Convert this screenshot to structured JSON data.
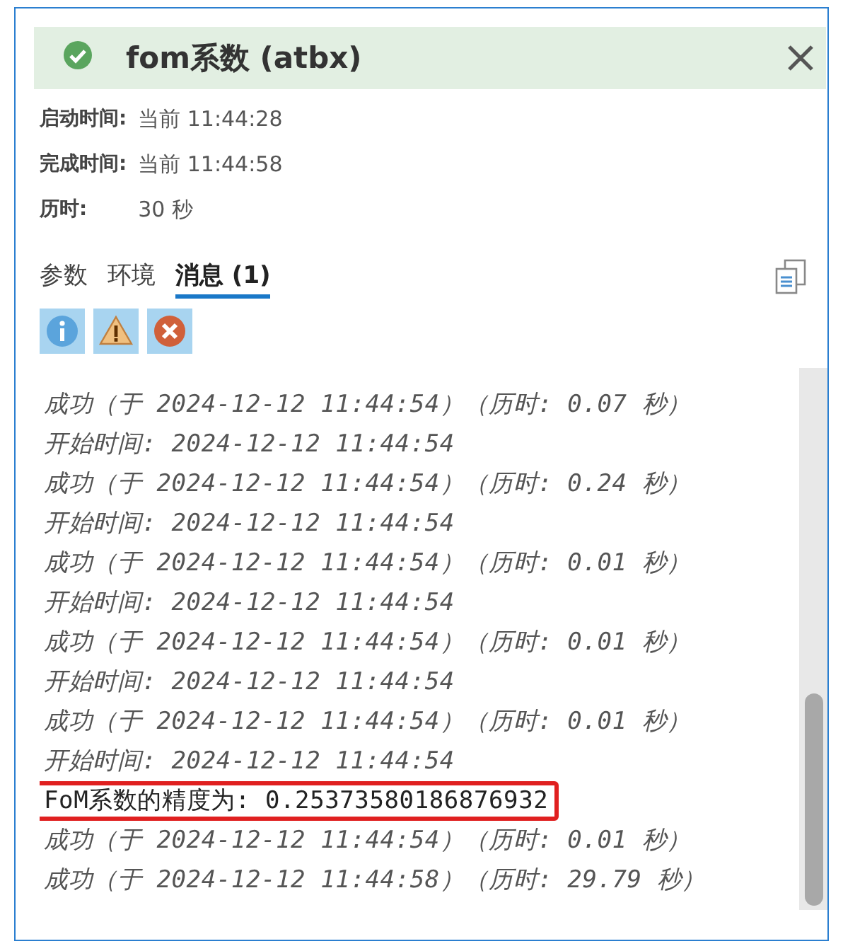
{
  "header": {
    "title": "fom系数 (atbx)",
    "succeeded": true
  },
  "details": [
    {
      "label": "启动时间:",
      "value": "当前 11:44:28"
    },
    {
      "label": "完成时间:",
      "value": "当前 11:44:58"
    },
    {
      "label": "历时:",
      "value": "30 秒"
    }
  ],
  "tabs": [
    {
      "label": "参数",
      "selected": false
    },
    {
      "label": "环境",
      "selected": false
    },
    {
      "label": "消息 (1)",
      "selected": true
    }
  ],
  "filters": [
    {
      "kind": "info",
      "on": true
    },
    {
      "kind": "warning",
      "on": true
    },
    {
      "kind": "error",
      "on": true
    }
  ],
  "messages": [
    {
      "kind": "status",
      "text": "成功（于 2024-12-12 11:44:54）（历时: 0.07 秒）",
      "highlighted": false
    },
    {
      "kind": "status",
      "text": "开始时间: 2024-12-12 11:44:54",
      "highlighted": false
    },
    {
      "kind": "status",
      "text": "成功（于 2024-12-12 11:44:54）（历时: 0.24 秒）",
      "highlighted": false
    },
    {
      "kind": "status",
      "text": "开始时间: 2024-12-12 11:44:54",
      "highlighted": false
    },
    {
      "kind": "status",
      "text": "成功（于 2024-12-12 11:44:54）（历时: 0.01 秒）",
      "highlighted": false
    },
    {
      "kind": "status",
      "text": "开始时间: 2024-12-12 11:44:54",
      "highlighted": false
    },
    {
      "kind": "status",
      "text": "成功（于 2024-12-12 11:44:54）（历时: 0.01 秒）",
      "highlighted": false
    },
    {
      "kind": "status",
      "text": "开始时间: 2024-12-12 11:44:54",
      "highlighted": false
    },
    {
      "kind": "status",
      "text": "成功（于 2024-12-12 11:44:54）（历时: 0.01 秒）",
      "highlighted": false
    },
    {
      "kind": "status",
      "text": "开始时间: 2024-12-12 11:44:54",
      "highlighted": false
    },
    {
      "kind": "output",
      "text": "FoM系数的精度为: 0.25373580186876932",
      "highlighted": true
    },
    {
      "kind": "status",
      "text": "成功（于 2024-12-12 11:44:54）（历时: 0.01 秒）",
      "highlighted": false
    },
    {
      "kind": "status",
      "text": "成功（于 2024-12-12 11:44:58）（历时: 29.79 秒）",
      "highlighted": false
    }
  ]
}
